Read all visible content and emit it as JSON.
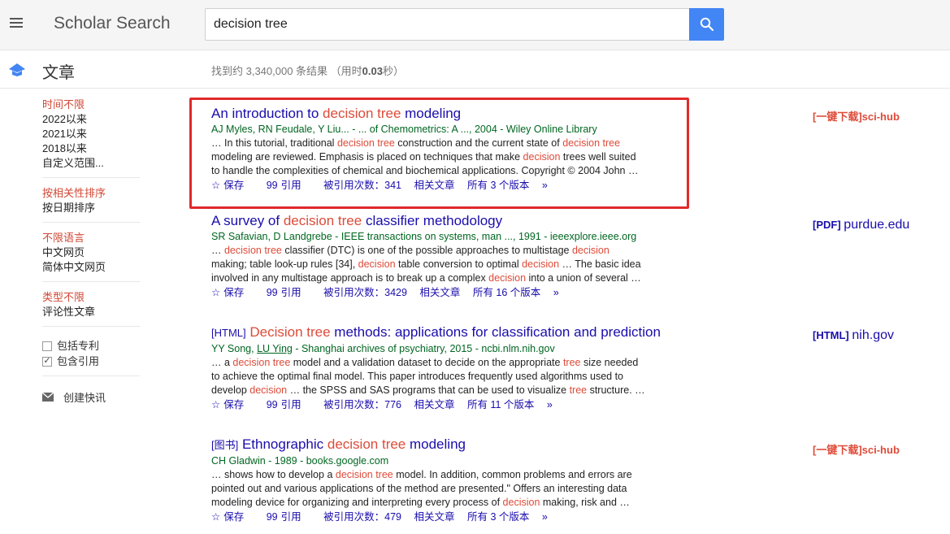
{
  "header": {
    "brand": "Scholar Search",
    "search_value": "decision tree",
    "menu_icon": "hamburger-icon",
    "search_icon": "search-icon"
  },
  "subbar": {
    "label": "文章",
    "stats_prefix": "找到约 3,340,000 条结果 （用时",
    "stats_time": "0.03",
    "stats_suffix": "秒）"
  },
  "filters": {
    "time": [
      "时间不限",
      "2022以来",
      "2021以来",
      "2018以来",
      "自定义范围..."
    ],
    "sort": [
      "按相关性排序",
      "按日期排序"
    ],
    "language": [
      "不限语言",
      "中文网页",
      "简体中文网页"
    ],
    "type": [
      "类型不限",
      "评论性文章"
    ],
    "include_patents": "包括专利",
    "include_citations": "包含引用",
    "create_alert": "创建快讯"
  },
  "results": [
    {
      "tag": "",
      "title_parts": [
        "An introduction to ",
        "decision tree",
        " modeling"
      ],
      "meta": "AJ Myles, RN Feudale, Y Liu... - ... of Chemometrics: A ..., 2004 - Wiley Online Library",
      "snippet": [
        [
          "… In this tutorial, traditional ",
          "decision tree",
          " construction and the current state of ",
          "decision tree",
          ""
        ],
        [
          "modeling are reviewed. Emphasis is placed on techniques that make ",
          "decision",
          " trees well suited"
        ],
        [
          "to handle the complexities of chemical and biochemical applications. Copyright © 2004 John …"
        ]
      ],
      "actions": {
        "save": "保存",
        "cite": "引用",
        "cited_by": "被引用次数：341",
        "related": "相关文章",
        "versions": "所有 3 个版本"
      }
    },
    {
      "tag": "",
      "title_parts": [
        "A survey of ",
        "decision tree",
        " classifier methodology"
      ],
      "meta": "SR Safavian, D Landgrebe - IEEE transactions on systems, man ..., 1991 - ieeexplore.ieee.org",
      "snippet": [
        [
          "… ",
          "decision tree",
          " classifier (DTC) is one of the possible approaches to multistage ",
          "decision",
          ""
        ],
        [
          "making; table look-up rules [34], ",
          "decision",
          " table conversion to optimal ",
          "decision",
          " … The basic idea"
        ],
        [
          "involved in any multistage approach is to break up a complex ",
          "decision",
          " into a union of several …"
        ]
      ],
      "actions": {
        "save": "保存",
        "cite": "引用",
        "cited_by": "被引用次数：3429",
        "related": "相关文章",
        "versions": "所有 16 个版本"
      }
    },
    {
      "tag": "[HTML]",
      "title_parts": [
        " ",
        "Decision tree",
        " methods: applications for classification and prediction"
      ],
      "meta_parts": [
        "YY Song, ",
        "LU Ying",
        " - Shanghai archives of psychiatry, 2015 - ncbi.nlm.nih.gov"
      ],
      "snippet": [
        [
          "… a ",
          "decision tree",
          " model and a validation dataset to decide on the appropriate ",
          "tree",
          " size needed"
        ],
        [
          "to achieve the optimal final model. This paper introduces frequently used algorithms used to"
        ],
        [
          "develop ",
          "decision",
          " … the SPSS and SAS programs that can be used to visualize ",
          "tree",
          " structure. …"
        ]
      ],
      "actions": {
        "save": "保存",
        "cite": "引用",
        "cited_by": "被引用次数：776",
        "related": "相关文章",
        "versions": "所有 11 个版本"
      }
    },
    {
      "tag": "[图书]",
      "title_parts": [
        " Ethnographic ",
        "decision tree",
        " modeling"
      ],
      "meta": "CH Gladwin - 1989 - books.google.com",
      "snippet": [
        [
          "… shows how to develop a ",
          "decision tree",
          " model. In addition, common problems and errors are"
        ],
        [
          "pointed out and various applications of the method are presented.\" Offers an interesting data"
        ],
        [
          "modeling device for organizing and interpreting every process of ",
          "decision",
          " making, risk and …"
        ]
      ],
      "actions": {
        "save": "保存",
        "cite": "引用",
        "cited_by": "被引用次数：479",
        "related": "相关文章",
        "versions": "所有 3 个版本"
      }
    }
  ],
  "side_links": [
    {
      "text": "[一键下载]sci-hub"
    },
    {
      "format": "[PDF]",
      "domain": "purdue.edu"
    },
    {
      "format": "[HTML]",
      "domain": "nih.gov"
    },
    {
      "text": "[一键下载]sci-hub"
    }
  ],
  "colors": {
    "accent": "#4285f4",
    "highlight": "#dd4b39",
    "link": "#1a0dab",
    "meta": "#006621",
    "box": "#e02a2a"
  }
}
